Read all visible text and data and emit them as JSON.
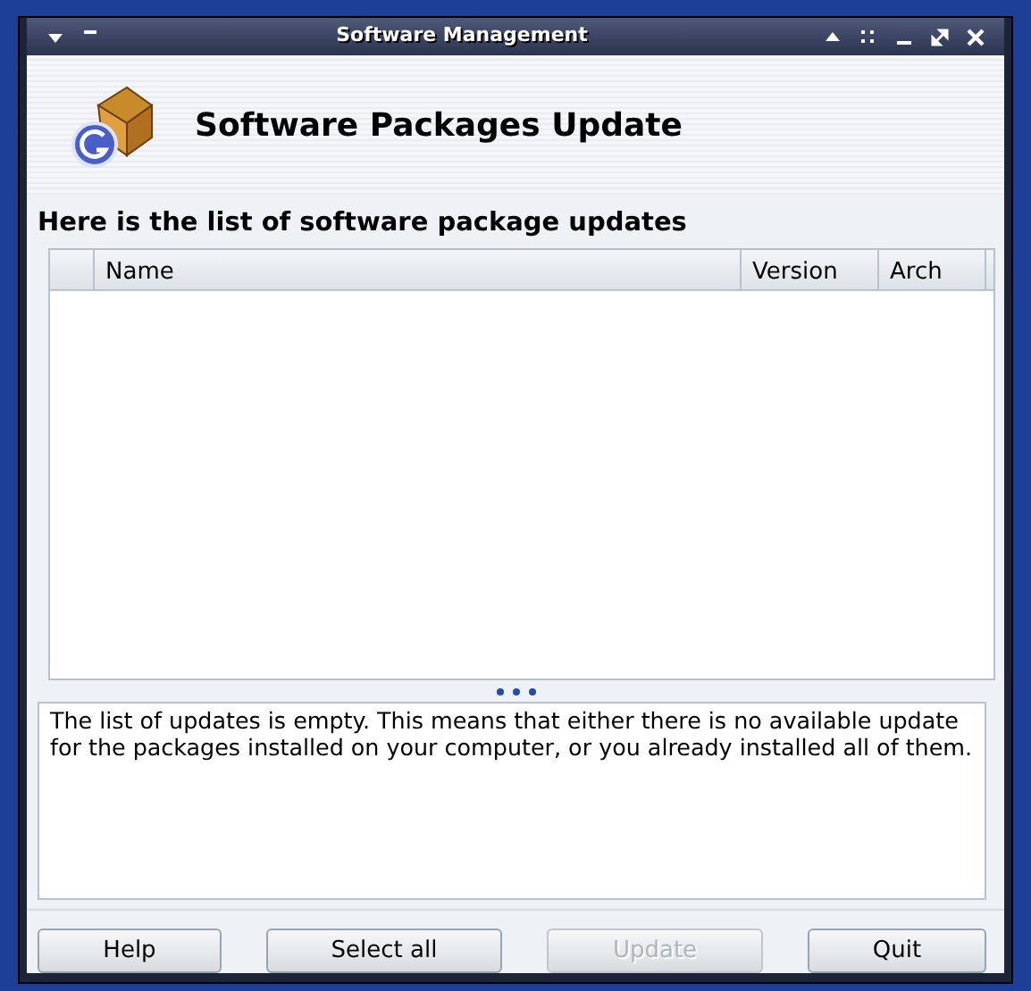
{
  "window": {
    "title": "Software Management"
  },
  "header": {
    "title": "Software Packages Update"
  },
  "list_heading": "Here is the list of software package updates",
  "table": {
    "columns": [
      "Name",
      "Version",
      "Arch"
    ]
  },
  "info_text": "The list of updates is empty. This means that either there is no available update for the packages installed on your computer, or you already installed all of them.",
  "buttons": [
    {
      "label": "Help",
      "disabled": false
    },
    {
      "label": "Select all",
      "disabled": false
    },
    {
      "label": "Update",
      "disabled": true
    },
    {
      "label": "Quit",
      "disabled": false
    }
  ]
}
